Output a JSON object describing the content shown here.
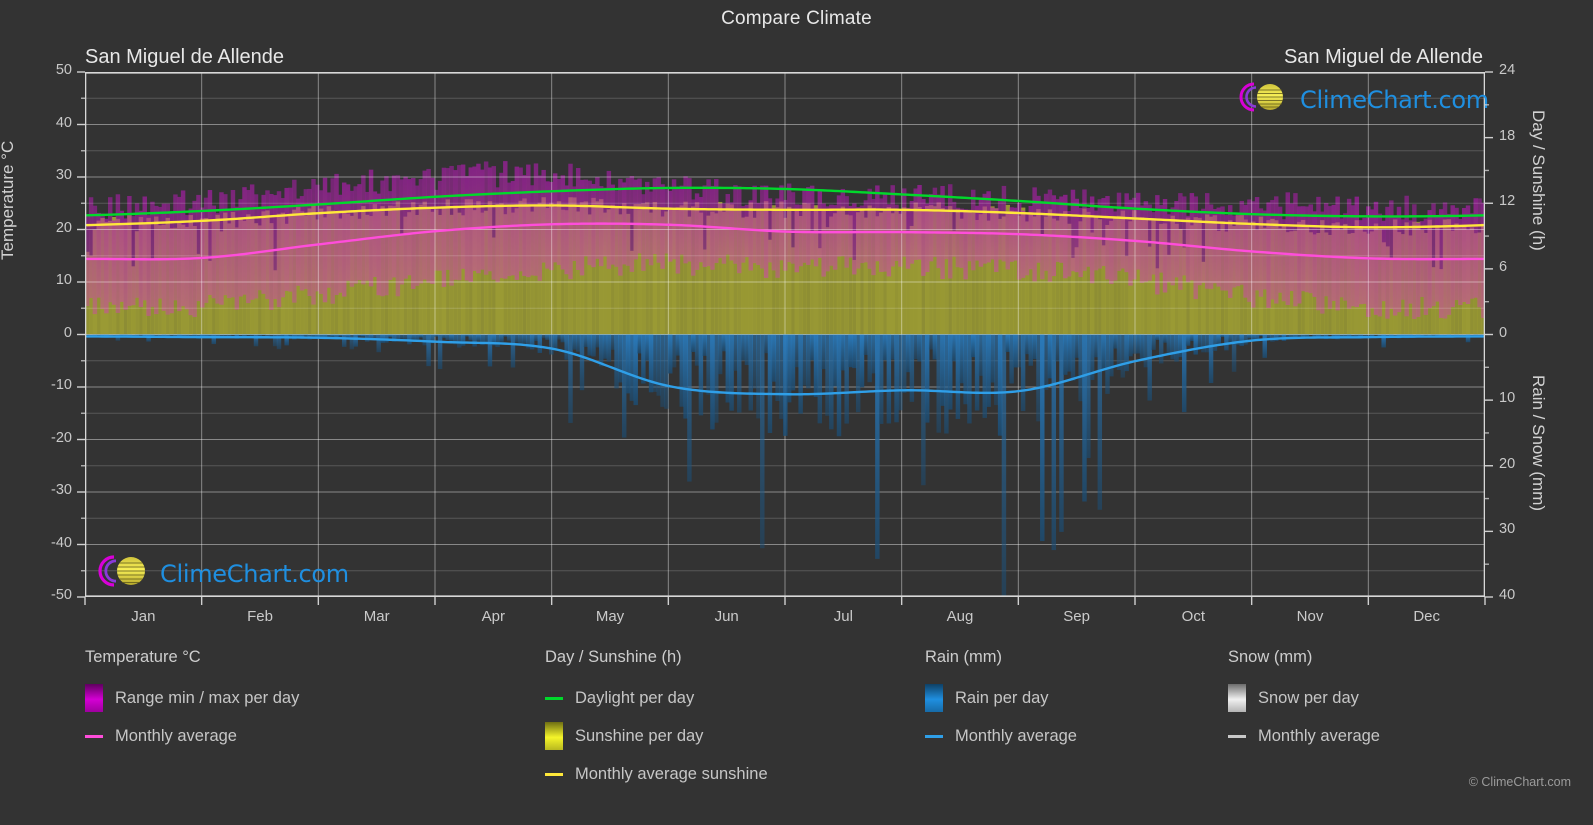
{
  "header": {
    "title": "Compare Climate",
    "station_left": "San Miguel de Allende",
    "station_right": "San Miguel de Allende"
  },
  "axes": {
    "left_title": "Temperature °C",
    "right_title_top": "Day / Sunshine (h)",
    "right_title_bottom": "Rain / Snow (mm)",
    "left_ticks": [
      "50",
      "40",
      "30",
      "20",
      "10",
      "0",
      "-10",
      "-20",
      "-30",
      "-40",
      "-50"
    ],
    "right_ticks_top": [
      "24",
      "18",
      "12",
      "6",
      "0"
    ],
    "right_ticks_bottom": [
      "10",
      "20",
      "30",
      "40"
    ],
    "x_ticks": [
      "Jan",
      "Feb",
      "Mar",
      "Apr",
      "May",
      "Jun",
      "Jul",
      "Aug",
      "Sep",
      "Oct",
      "Nov",
      "Dec"
    ]
  },
  "logo": {
    "brand": "ClimeChart.com",
    "copyright": "© ClimeChart.com"
  },
  "legend": {
    "temperature": {
      "title": "Temperature °C",
      "items": [
        {
          "label": "Range min / max per day",
          "type": "swatch",
          "color": "#d400d4"
        },
        {
          "label": "Monthly average",
          "type": "line",
          "color": "#ff4ddb"
        }
      ]
    },
    "day_sunshine": {
      "title": "Day / Sunshine (h)",
      "items": [
        {
          "label": "Daylight per day",
          "type": "line",
          "color": "#00d92b"
        },
        {
          "label": "Sunshine per day",
          "type": "swatch",
          "color": "#f5f52a"
        },
        {
          "label": "Monthly average sunshine",
          "type": "line",
          "color": "#ffe83a"
        }
      ]
    },
    "rain": {
      "title": "Rain (mm)",
      "items": [
        {
          "label": "Rain per day",
          "type": "swatch",
          "color": "#1f8fe0"
        },
        {
          "label": "Monthly average",
          "type": "line",
          "color": "#2f9fe8"
        }
      ]
    },
    "snow": {
      "title": "Snow (mm)",
      "items": [
        {
          "label": "Snow per day",
          "type": "swatch",
          "color": "#f0f0f0"
        },
        {
          "label": "Monthly average",
          "type": "line",
          "color": "#c8c8c8"
        }
      ]
    }
  },
  "chart_data": {
    "type": "area",
    "title": "Compare Climate",
    "subtitle": "San Miguel de Allende",
    "xlabel": "",
    "ylabel": "Temperature °C",
    "ylabel_right_top": "Day / Sunshine (h)",
    "ylabel_right_bottom": "Rain / Snow (mm)",
    "ylim": [
      -50,
      50
    ],
    "ylim_right_top": [
      0,
      24
    ],
    "ylim_right_bottom": [
      0,
      40
    ],
    "grid": true,
    "legend_position": "bottom",
    "categories": [
      "Jan",
      "Feb",
      "Mar",
      "Apr",
      "May",
      "Jun",
      "Jul",
      "Aug",
      "Sep",
      "Oct",
      "Nov",
      "Dec"
    ],
    "series": [
      {
        "name": "Temperature monthly average (°C)",
        "color": "#ff4ddb",
        "unit": "°C",
        "values": [
          14.4,
          14.6,
          17.2,
          19.7,
          21.0,
          20.9,
          19.6,
          19.5,
          19.1,
          17.8,
          15.8,
          14.5
        ]
      },
      {
        "name": "Temperature daily max (°C)",
        "color": "#d400d4",
        "unit": "°C",
        "values": [
          23.8,
          25.2,
          27.9,
          29.8,
          30.1,
          28.0,
          26.1,
          26.0,
          25.4,
          25.0,
          24.5,
          23.7
        ]
      },
      {
        "name": "Temperature daily min (°C)",
        "color": "#d400d4",
        "unit": "°C",
        "values": [
          5.0,
          5.6,
          7.6,
          10.2,
          12.3,
          13.4,
          12.8,
          12.7,
          12.4,
          10.3,
          7.3,
          5.3
        ]
      },
      {
        "name": "Daylight per day (h)",
        "color": "#00d92b",
        "unit": "h",
        "values": [
          10.9,
          11.3,
          11.9,
          12.6,
          13.1,
          13.4,
          13.3,
          12.8,
          12.2,
          11.5,
          11.0,
          10.8
        ]
      },
      {
        "name": "Monthly average sunshine (h)",
        "color": "#ffe83a",
        "unit": "h",
        "values": [
          10.0,
          10.4,
          11.1,
          11.6,
          11.8,
          11.5,
          11.4,
          11.4,
          11.1,
          10.6,
          10.1,
          9.8
        ]
      },
      {
        "name": "Rain monthly average (mm)",
        "color": "#2f9fe8",
        "unit": "mm",
        "values": [
          0.3,
          0.4,
          0.5,
          1.1,
          2.2,
          7.9,
          9.1,
          8.5,
          8.6,
          4.0,
          0.9,
          0.4
        ]
      },
      {
        "name": "Snow monthly average (mm)",
        "color": "#c8c8c8",
        "unit": "mm",
        "values": [
          0,
          0,
          0,
          0,
          0,
          0,
          0,
          0,
          0,
          0,
          0,
          0
        ]
      }
    ]
  }
}
